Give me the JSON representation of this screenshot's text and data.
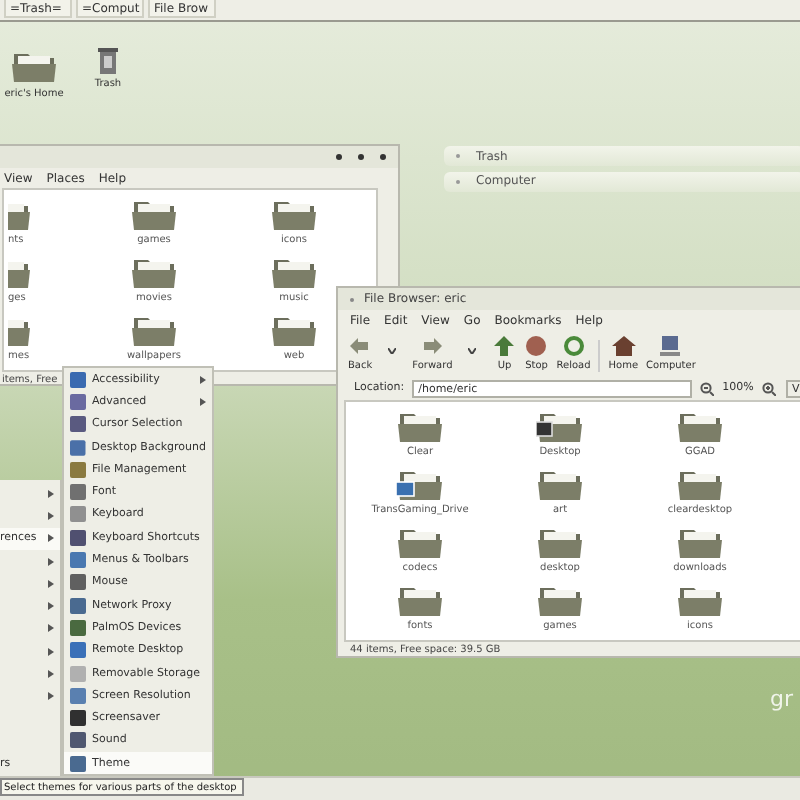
{
  "top_panel": {
    "tasks": [
      {
        "label": "=Trash="
      },
      {
        "label": "=Comput"
      },
      {
        "label": "File Brow"
      }
    ]
  },
  "desktop_icons": [
    {
      "label": "eric's Home",
      "kind": "home"
    },
    {
      "label": "Trash",
      "kind": "trash"
    }
  ],
  "places_list": [
    {
      "label": "Trash"
    },
    {
      "label": "Computer"
    }
  ],
  "back_window": {
    "menu": [
      "View",
      "Places",
      "Help"
    ],
    "folders": [
      [
        "nts",
        "games",
        "icons"
      ],
      [
        "ges",
        "movies",
        "music"
      ],
      [
        "mes",
        "wallpapers",
        "web"
      ]
    ],
    "status": "items, Free"
  },
  "main_menu": [
    {
      "has_submenu": true
    },
    {
      "has_submenu": true
    },
    {
      "label": "rences",
      "has_submenu": true,
      "selected": true
    },
    {
      "has_submenu": true,
      "selected": false
    },
    {
      "has_submenu": true,
      "selected": false
    },
    {
      "has_submenu": true,
      "selected": false
    },
    {
      "has_submenu": true,
      "selected": false
    },
    {
      "has_submenu": true,
      "selected": false
    },
    {
      "has_submenu": true,
      "selected": false
    },
    {
      "has_submenu": true,
      "selected": false
    },
    {
      "has_submenu": false
    },
    {
      "has_submenu": false
    },
    {
      "label": "rs",
      "has_submenu": false,
      "selected": false
    }
  ],
  "preferences_menu": [
    {
      "label": "Accessibility",
      "has_submenu": true,
      "selected": false,
      "color": "#3a6ab0"
    },
    {
      "label": "Advanced",
      "has_submenu": true,
      "selected": false,
      "color": "#6a6aa0"
    },
    {
      "label": "Cursor Selection",
      "has_submenu": false,
      "selected": false,
      "color": "#5a5a80"
    },
    {
      "label": "Desktop Background",
      "has_submenu": false,
      "selected": false,
      "color": "#4a70a8"
    },
    {
      "label": "File Management",
      "has_submenu": false,
      "selected": false,
      "color": "#8a7a40"
    },
    {
      "label": "Font",
      "has_submenu": false,
      "selected": false,
      "color": "#707070"
    },
    {
      "label": "Keyboard",
      "has_submenu": false,
      "selected": false,
      "color": "#909090"
    },
    {
      "label": "Keyboard Shortcuts",
      "has_submenu": false,
      "selected": false,
      "color": "#505070"
    },
    {
      "label": "Menus & Toolbars",
      "has_submenu": false,
      "selected": false,
      "color": "#4a78b0"
    },
    {
      "label": "Mouse",
      "has_submenu": false,
      "selected": false,
      "color": "#606060"
    },
    {
      "label": "Network Proxy",
      "has_submenu": false,
      "selected": false,
      "color": "#4a6a90"
    },
    {
      "label": "PalmOS Devices",
      "has_submenu": false,
      "selected": false,
      "color": "#4a6a40"
    },
    {
      "label": "Remote Desktop",
      "has_submenu": false,
      "selected": false,
      "color": "#3a70b8"
    },
    {
      "label": "Removable Storage",
      "has_submenu": false,
      "selected": false,
      "color": "#b0b0b0"
    },
    {
      "label": "Screen Resolution",
      "has_submenu": false,
      "selected": false,
      "color": "#5a80b0"
    },
    {
      "label": "Screensaver",
      "has_submenu": false,
      "selected": false,
      "color": "#303030"
    },
    {
      "label": "Sound",
      "has_submenu": false,
      "selected": false,
      "color": "#505870"
    },
    {
      "label": "Theme",
      "has_submenu": false,
      "selected": true,
      "color": "#4a6a90"
    }
  ],
  "tooltip": "Select themes for various parts of the desktop",
  "file_browser": {
    "title": "File Browser: eric",
    "menu": [
      "File",
      "Edit",
      "View",
      "Go",
      "Bookmarks",
      "Help"
    ],
    "toolbar": [
      {
        "label": "Back",
        "kind": "back",
        "dropdown": true
      },
      {
        "label": "Forward",
        "kind": "forward",
        "dropdown": true
      },
      {
        "label": "Up",
        "kind": "up"
      },
      {
        "label": "Stop",
        "kind": "stop"
      },
      {
        "label": "Reload",
        "kind": "reload"
      },
      {
        "label": "Home",
        "kind": "home"
      },
      {
        "label": "Computer",
        "kind": "computer"
      }
    ],
    "location_label": "Location:",
    "location": "/home/eric",
    "zoom": "100%",
    "view_button": "V",
    "folders": [
      {
        "label": "Clear",
        "kind": "folder"
      },
      {
        "label": "Desktop",
        "kind": "desktop"
      },
      {
        "label": "GGAD",
        "kind": "folder"
      },
      {
        "label": "TransGaming_Drive",
        "kind": "drive"
      },
      {
        "label": "art",
        "kind": "folder"
      },
      {
        "label": "cleardesktop",
        "kind": "folder"
      },
      {
        "label": "codecs",
        "kind": "folder"
      },
      {
        "label": "desktop",
        "kind": "folder"
      },
      {
        "label": "downloads",
        "kind": "folder"
      },
      {
        "label": "fonts",
        "kind": "folder"
      },
      {
        "label": "games",
        "kind": "folder"
      },
      {
        "label": "icons",
        "kind": "folder"
      }
    ],
    "status": "44 items, Free space: 39.5 GB"
  },
  "desktop_text": "gr"
}
